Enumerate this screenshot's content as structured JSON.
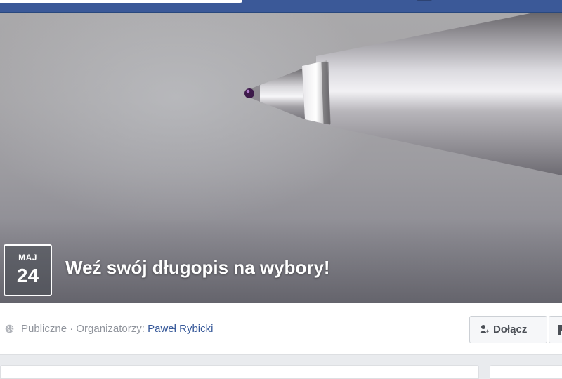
{
  "event": {
    "month": "MAJ",
    "day": "24",
    "title": "Weź swój długopis na wybory!"
  },
  "info": {
    "privacy_label": "Publiczne",
    "separator": " · ",
    "organizers_label": "Organizatorzy: ",
    "organizer_name": "Paweł Rybicki"
  },
  "actions": {
    "join_label": "Dołącz"
  },
  "icons": {
    "privacy": "globe-icon",
    "join": "add-person-icon",
    "next_action": "flag-icon"
  },
  "colors": {
    "header": "#3b5998",
    "link": "#365899",
    "muted_text": "#90949c",
    "button_text": "#4b4f56"
  }
}
